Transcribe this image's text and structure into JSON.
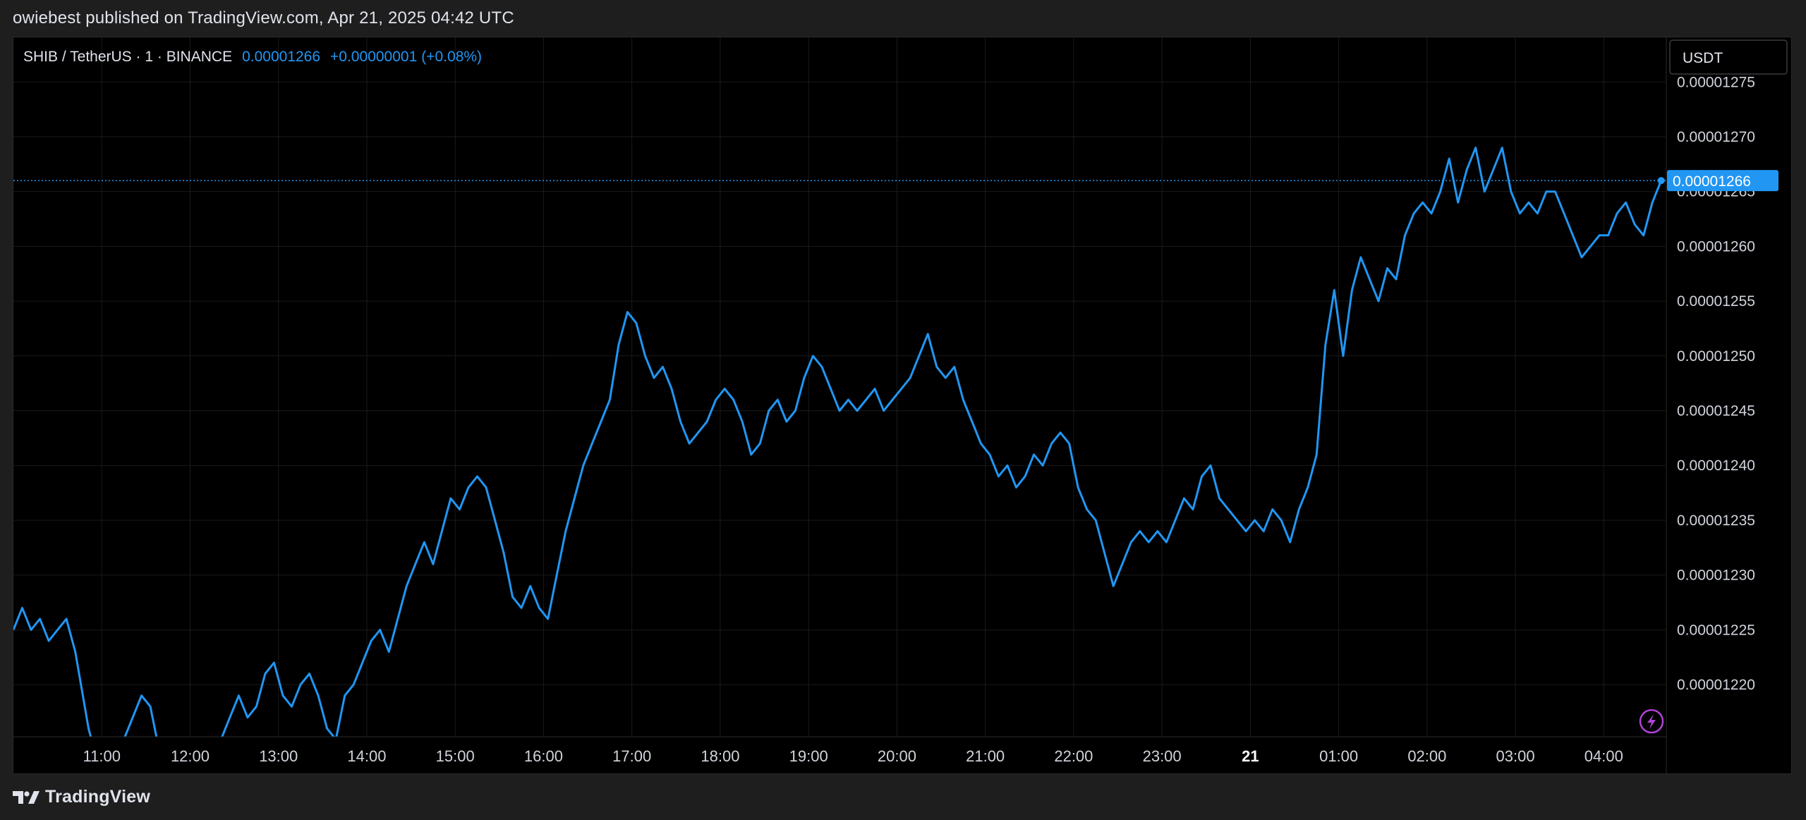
{
  "header": {
    "published_text": "owiebest published on TradingView.com, Apr 21, 2025 04:42 UTC"
  },
  "footer": {
    "brand": "TradingView",
    "brand_icon": "tradingview-logo-icon"
  },
  "symbol": {
    "pair": "SHIB / TetherUS",
    "interval": "1",
    "exchange": "BINANCE",
    "last": "0.00001266",
    "change": "+0.00000001",
    "change_pct": "(+0.08%)"
  },
  "price_axis": {
    "currency": "USDT",
    "tick_labels": [
      "0.00001275",
      "0.00001270",
      "0.00001265",
      "0.00001260",
      "0.00001255",
      "0.00001250",
      "0.00001245",
      "0.00001240",
      "0.00001235",
      "0.00001230",
      "0.00001225",
      "0.00001220"
    ],
    "last_price_label": "0.00001266"
  },
  "time_axis": {
    "tick_labels": [
      "11:00",
      "12:00",
      "13:00",
      "14:00",
      "15:00",
      "16:00",
      "17:00",
      "18:00",
      "19:00",
      "20:00",
      "21:00",
      "22:00",
      "23:00",
      "21",
      "01:00",
      "02:00",
      "03:00",
      "04:00"
    ],
    "bold_label": "21"
  },
  "colors": {
    "line": "#2196f3",
    "price_text": "#2196f3",
    "background": "#000000",
    "grid": "#1a1a1a",
    "bolt_icon": "#b042d6"
  },
  "chart_data": {
    "type": "line",
    "title": "SHIB / TetherUS · 1 · BINANCE",
    "xlabel": "",
    "ylabel": "",
    "x_unit": "hours (Apr 20 10:00 UTC = 10.0, Apr 21 04:00 = 28.0)",
    "xlim": [
      10.0,
      28.7
    ],
    "ylim": [
      1.21524e-05,
      1.27907e-05
    ],
    "grid": true,
    "legend": "none",
    "series": [
      {
        "name": "SHIB / TetherUS",
        "points": [
          [
            10.0,
            1.225e-05
          ],
          [
            10.1,
            1.227e-05
          ],
          [
            10.2,
            1.225e-05
          ],
          [
            10.3,
            1.226e-05
          ],
          [
            10.4,
            1.224e-05
          ],
          [
            10.5,
            1.225e-05
          ],
          [
            10.6,
            1.226e-05
          ],
          [
            10.7,
            1.223e-05
          ],
          [
            10.85,
            1.216e-05
          ],
          [
            10.95,
            1.213e-05
          ],
          [
            11.05,
            1.214e-05
          ],
          [
            11.15,
            1.212e-05
          ],
          [
            11.25,
            1.215e-05
          ],
          [
            11.35,
            1.217e-05
          ],
          [
            11.45,
            1.219e-05
          ],
          [
            11.55,
            1.218e-05
          ],
          [
            11.65,
            1.214e-05
          ],
          [
            11.75,
            1.211e-05
          ],
          [
            11.85,
            1.21e-05
          ],
          [
            12.0,
            1.208e-05
          ],
          [
            12.15,
            1.209e-05
          ],
          [
            12.25,
            1.211e-05
          ],
          [
            12.35,
            1.215e-05
          ],
          [
            12.45,
            1.217e-05
          ],
          [
            12.55,
            1.219e-05
          ],
          [
            12.65,
            1.217e-05
          ],
          [
            12.75,
            1.218e-05
          ],
          [
            12.85,
            1.221e-05
          ],
          [
            12.95,
            1.222e-05
          ],
          [
            13.05,
            1.219e-05
          ],
          [
            13.15,
            1.218e-05
          ],
          [
            13.25,
            1.22e-05
          ],
          [
            13.35,
            1.221e-05
          ],
          [
            13.45,
            1.219e-05
          ],
          [
            13.55,
            1.216e-05
          ],
          [
            13.65,
            1.215e-05
          ],
          [
            13.75,
            1.219e-05
          ],
          [
            13.85,
            1.22e-05
          ],
          [
            13.95,
            1.222e-05
          ],
          [
            14.05,
            1.224e-05
          ],
          [
            14.15,
            1.225e-05
          ],
          [
            14.25,
            1.223e-05
          ],
          [
            14.35,
            1.226e-05
          ],
          [
            14.45,
            1.229e-05
          ],
          [
            14.55,
            1.231e-05
          ],
          [
            14.65,
            1.233e-05
          ],
          [
            14.75,
            1.231e-05
          ],
          [
            14.85,
            1.234e-05
          ],
          [
            14.95,
            1.237e-05
          ],
          [
            15.05,
            1.236e-05
          ],
          [
            15.15,
            1.238e-05
          ],
          [
            15.25,
            1.239e-05
          ],
          [
            15.35,
            1.238e-05
          ],
          [
            15.45,
            1.235e-05
          ],
          [
            15.55,
            1.232e-05
          ],
          [
            15.65,
            1.228e-05
          ],
          [
            15.75,
            1.227e-05
          ],
          [
            15.85,
            1.229e-05
          ],
          [
            15.95,
            1.227e-05
          ],
          [
            16.05,
            1.226e-05
          ],
          [
            16.15,
            1.23e-05
          ],
          [
            16.25,
            1.234e-05
          ],
          [
            16.35,
            1.237e-05
          ],
          [
            16.45,
            1.24e-05
          ],
          [
            16.55,
            1.242e-05
          ],
          [
            16.65,
            1.244e-05
          ],
          [
            16.75,
            1.246e-05
          ],
          [
            16.85,
            1.251e-05
          ],
          [
            16.95,
            1.254e-05
          ],
          [
            17.05,
            1.253e-05
          ],
          [
            17.15,
            1.25e-05
          ],
          [
            17.25,
            1.248e-05
          ],
          [
            17.35,
            1.249e-05
          ],
          [
            17.45,
            1.247e-05
          ],
          [
            17.55,
            1.244e-05
          ],
          [
            17.65,
            1.242e-05
          ],
          [
            17.75,
            1.243e-05
          ],
          [
            17.85,
            1.244e-05
          ],
          [
            17.95,
            1.246e-05
          ],
          [
            18.05,
            1.247e-05
          ],
          [
            18.15,
            1.246e-05
          ],
          [
            18.25,
            1.244e-05
          ],
          [
            18.35,
            1.241e-05
          ],
          [
            18.45,
            1.242e-05
          ],
          [
            18.55,
            1.245e-05
          ],
          [
            18.65,
            1.246e-05
          ],
          [
            18.75,
            1.244e-05
          ],
          [
            18.85,
            1.245e-05
          ],
          [
            18.95,
            1.248e-05
          ],
          [
            19.05,
            1.25e-05
          ],
          [
            19.15,
            1.249e-05
          ],
          [
            19.25,
            1.247e-05
          ],
          [
            19.35,
            1.245e-05
          ],
          [
            19.45,
            1.246e-05
          ],
          [
            19.55,
            1.245e-05
          ],
          [
            19.65,
            1.246e-05
          ],
          [
            19.75,
            1.247e-05
          ],
          [
            19.85,
            1.245e-05
          ],
          [
            19.95,
            1.246e-05
          ],
          [
            20.05,
            1.247e-05
          ],
          [
            20.15,
            1.248e-05
          ],
          [
            20.25,
            1.25e-05
          ],
          [
            20.35,
            1.252e-05
          ],
          [
            20.45,
            1.249e-05
          ],
          [
            20.55,
            1.248e-05
          ],
          [
            20.65,
            1.249e-05
          ],
          [
            20.75,
            1.246e-05
          ],
          [
            20.85,
            1.244e-05
          ],
          [
            20.95,
            1.242e-05
          ],
          [
            21.05,
            1.241e-05
          ],
          [
            21.15,
            1.239e-05
          ],
          [
            21.25,
            1.24e-05
          ],
          [
            21.35,
            1.238e-05
          ],
          [
            21.45,
            1.239e-05
          ],
          [
            21.55,
            1.241e-05
          ],
          [
            21.65,
            1.24e-05
          ],
          [
            21.75,
            1.242e-05
          ],
          [
            21.85,
            1.243e-05
          ],
          [
            21.95,
            1.242e-05
          ],
          [
            22.05,
            1.238e-05
          ],
          [
            22.15,
            1.236e-05
          ],
          [
            22.25,
            1.235e-05
          ],
          [
            22.35,
            1.232e-05
          ],
          [
            22.45,
            1.229e-05
          ],
          [
            22.55,
            1.231e-05
          ],
          [
            22.65,
            1.233e-05
          ],
          [
            22.75,
            1.234e-05
          ],
          [
            22.85,
            1.233e-05
          ],
          [
            22.95,
            1.234e-05
          ],
          [
            23.05,
            1.233e-05
          ],
          [
            23.15,
            1.235e-05
          ],
          [
            23.25,
            1.237e-05
          ],
          [
            23.35,
            1.236e-05
          ],
          [
            23.45,
            1.239e-05
          ],
          [
            23.55,
            1.24e-05
          ],
          [
            23.65,
            1.237e-05
          ],
          [
            23.75,
            1.236e-05
          ],
          [
            23.85,
            1.235e-05
          ],
          [
            23.95,
            1.234e-05
          ],
          [
            24.05,
            1.235e-05
          ],
          [
            24.15,
            1.234e-05
          ],
          [
            24.25,
            1.236e-05
          ],
          [
            24.35,
            1.235e-05
          ],
          [
            24.45,
            1.233e-05
          ],
          [
            24.55,
            1.236e-05
          ],
          [
            24.65,
            1.238e-05
          ],
          [
            24.75,
            1.241e-05
          ],
          [
            24.85,
            1.251e-05
          ],
          [
            24.95,
            1.256e-05
          ],
          [
            25.05,
            1.25e-05
          ],
          [
            25.15,
            1.256e-05
          ],
          [
            25.25,
            1.259e-05
          ],
          [
            25.35,
            1.257e-05
          ],
          [
            25.45,
            1.255e-05
          ],
          [
            25.55,
            1.258e-05
          ],
          [
            25.65,
            1.257e-05
          ],
          [
            25.75,
            1.261e-05
          ],
          [
            25.85,
            1.263e-05
          ],
          [
            25.95,
            1.264e-05
          ],
          [
            26.05,
            1.263e-05
          ],
          [
            26.15,
            1.265e-05
          ],
          [
            26.25,
            1.268e-05
          ],
          [
            26.35,
            1.264e-05
          ],
          [
            26.45,
            1.267e-05
          ],
          [
            26.55,
            1.269e-05
          ],
          [
            26.65,
            1.265e-05
          ],
          [
            26.75,
            1.267e-05
          ],
          [
            26.85,
            1.269e-05
          ],
          [
            26.95,
            1.265e-05
          ],
          [
            27.05,
            1.263e-05
          ],
          [
            27.15,
            1.264e-05
          ],
          [
            27.25,
            1.263e-05
          ],
          [
            27.35,
            1.265e-05
          ],
          [
            27.45,
            1.265e-05
          ],
          [
            27.55,
            1.263e-05
          ],
          [
            27.65,
            1.261e-05
          ],
          [
            27.75,
            1.259e-05
          ],
          [
            27.85,
            1.26e-05
          ],
          [
            27.95,
            1.261e-05
          ],
          [
            28.05,
            1.261e-05
          ],
          [
            28.15,
            1.263e-05
          ],
          [
            28.25,
            1.264e-05
          ],
          [
            28.35,
            1.262e-05
          ],
          [
            28.45,
            1.261e-05
          ],
          [
            28.55,
            1.264e-05
          ],
          [
            28.65,
            1.266e-05
          ]
        ]
      }
    ]
  }
}
